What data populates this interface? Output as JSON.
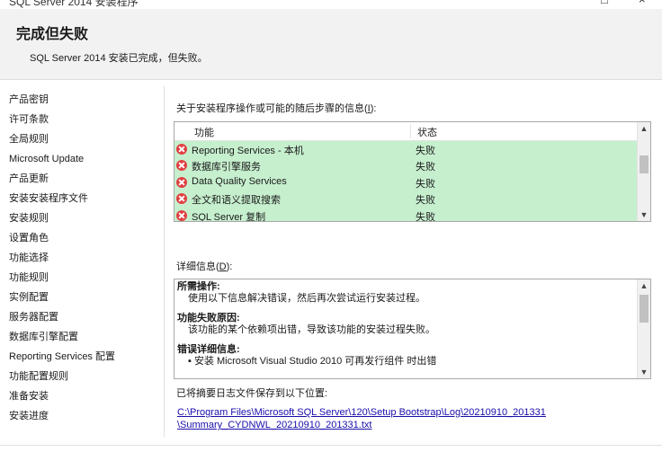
{
  "window": {
    "title": "SQL Server 2014 安装程序",
    "minimize_glyph": "□",
    "close_glyph": "×"
  },
  "header": {
    "title": "完成但失败",
    "subtitle": "SQL Server 2014 安装已完成，但失败。"
  },
  "nav": {
    "items": [
      {
        "label": "产品密钥"
      },
      {
        "label": "许可条款"
      },
      {
        "label": "全局规则"
      },
      {
        "label": "Microsoft Update"
      },
      {
        "label": "产品更新"
      },
      {
        "label": "安装安装程序文件"
      },
      {
        "label": "安装规则"
      },
      {
        "label": "设置角色"
      },
      {
        "label": "功能选择"
      },
      {
        "label": "功能规则"
      },
      {
        "label": "实例配置"
      },
      {
        "label": "服务器配置"
      },
      {
        "label": "数据库引擎配置"
      },
      {
        "label": "Reporting Services 配置"
      },
      {
        "label": "功能配置规则"
      },
      {
        "label": "准备安装"
      },
      {
        "label": "安装进度"
      }
    ]
  },
  "main": {
    "info_label_pre": "关于安装程序操作或可能的随后步骤的信息(",
    "info_label_key": "I",
    "info_label_post": "):",
    "table": {
      "columns": [
        "功能",
        "状态"
      ],
      "rows": [
        {
          "feature": "Reporting Services - 本机",
          "status": "失败"
        },
        {
          "feature": "数据库引擎服务",
          "status": "失败"
        },
        {
          "feature": "Data Quality Services",
          "status": "失败"
        },
        {
          "feature": "全文和语义提取搜索",
          "status": "失败"
        },
        {
          "feature": "SQL Server 复制",
          "status": "失败"
        }
      ]
    },
    "details_label_pre": "详细信息(",
    "details_label_key": "D",
    "details_label_post": "):",
    "details": {
      "h1": "所需操作:",
      "t1": "使用以下信息解决错误，然后再次尝试运行安装过程。",
      "h2": "功能失败原因:",
      "t2": "该功能的某个依赖项出错，导致该功能的安装过程失败。",
      "h3": "错误详细信息:",
      "t3": "▪  安装 Microsoft Visual Studio 2010 可再发行组件 时出错"
    },
    "log_label": "已将摘要日志文件保存到以下位置:",
    "log_path_line1": "C:\\Program Files\\Microsoft SQL Server\\120\\Setup Bootstrap\\Log\\20210910_201331",
    "log_path_line2": "\\Summary_CYDNWL_20210910_201331.txt"
  },
  "colors": {
    "success_row_bg": "#c6efce",
    "error_icon": "#e04040",
    "link": "#1a0dab",
    "header_bg": "#f2f2f2"
  }
}
